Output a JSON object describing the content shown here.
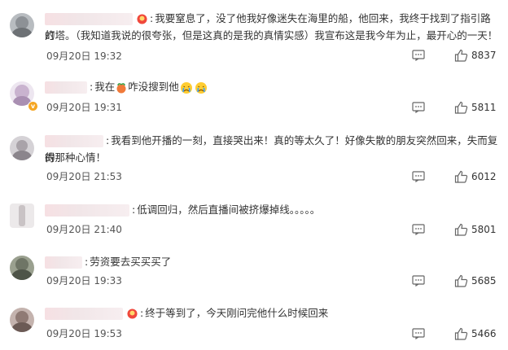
{
  "comments": [
    {
      "text_line1": "我要窒息了，没了他我好像迷失在海里的船，他回来，我终于找到了指引路的",
      "text_line2": "灯塔。（我知道我说的很夸张，但是这真的是我的真情实感）我宣布这是我今年为止，最开心的一天！",
      "date": "09月20日 19:32",
      "likes": "8837"
    },
    {
      "text_pre": "我在",
      "text_post": "咋没搜到他",
      "date": "09月20日 19:31",
      "likes": "5811"
    },
    {
      "text_line1": "我看到他开播的一刻，直接哭出来！真的等太久了！好像失散的朋友突然回来，失而复得",
      "text_line2": "的那种心情！",
      "date": "09月20日 21:53",
      "likes": "6012"
    },
    {
      "text": "低调回归，然后直播间被挤爆掉线。。。。。",
      "date": "09月20日 21:40",
      "likes": "5801"
    },
    {
      "text": "劳资要去买买买了",
      "date": "09月20日 19:33",
      "likes": "5685"
    },
    {
      "text": "终于等到了，今天刚问完他什么时候回来",
      "date": "09月20日 19:53",
      "likes": "5466"
    }
  ]
}
